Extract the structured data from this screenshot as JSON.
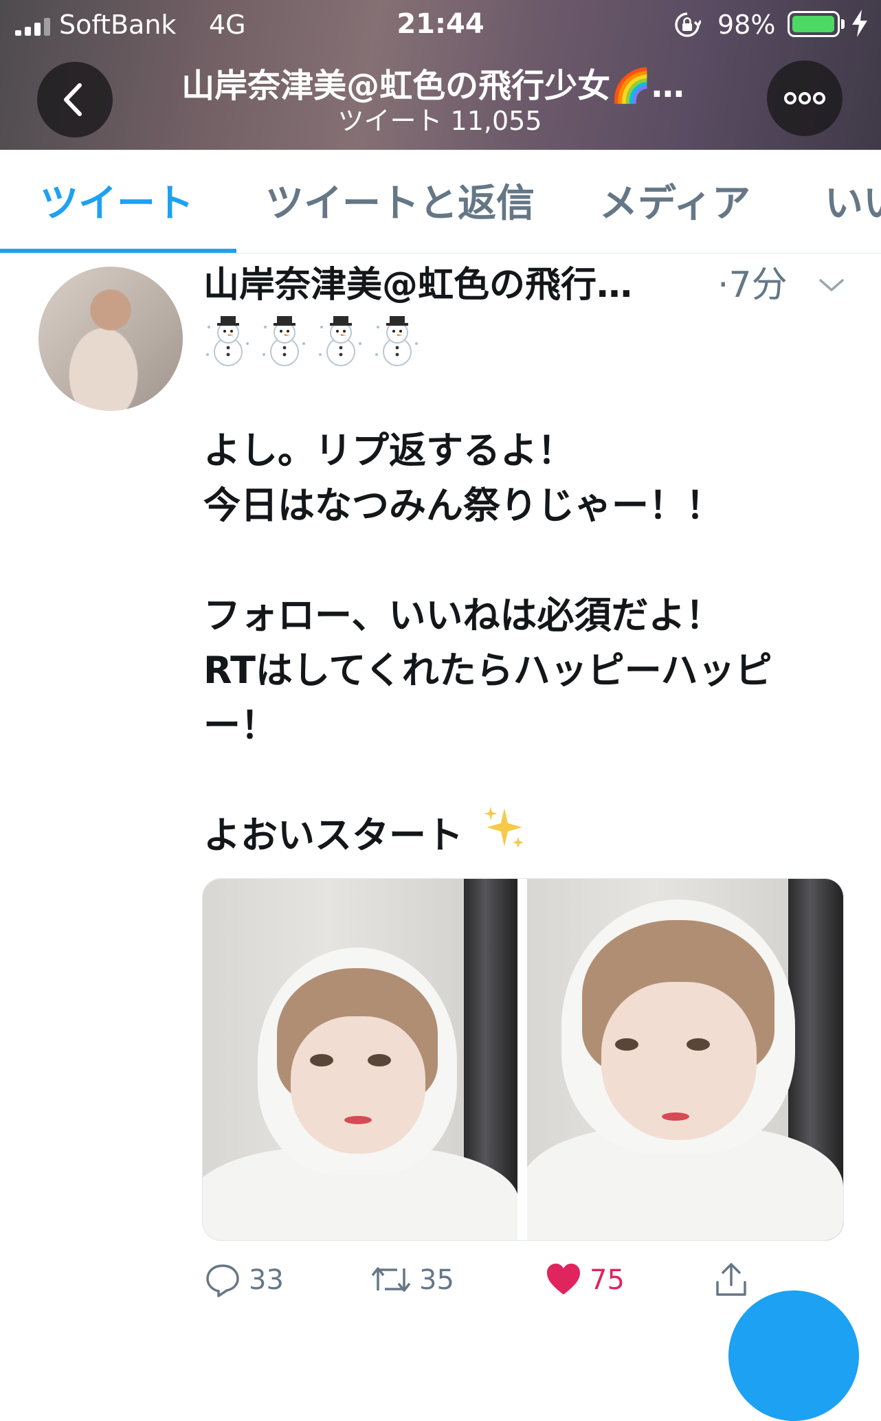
{
  "status_bar": {
    "carrier": "SoftBank",
    "network": "4G",
    "time": "21:44",
    "battery_percent": "98%",
    "battery_level": 0.98,
    "battery_color": "#4cd964"
  },
  "header": {
    "title": "山岸奈津美@虹色の飛行少女🌈…",
    "subtitle": "ツイート 11,055",
    "back_icon": "chevron-left-icon",
    "more_icon": "more-horizontal-icon"
  },
  "tabs": [
    {
      "label": "ツイート",
      "active": true
    },
    {
      "label": "ツイートと返信",
      "active": false
    },
    {
      "label": "メディア",
      "active": false
    },
    {
      "label": "いい",
      "active": false
    }
  ],
  "tweet": {
    "author": "山岸奈津美@虹色の飛行…",
    "time": "·7分",
    "emoji_line": "☃️☃️☃️☃️",
    "text": "よし。リプ返するよ！\n今日はなつみん祭りじゃー！！\n\nフォロー、いいねは必須だよ！\nRTはしてくれたらハッピーハッピ\nー！\n\nよおいスタート",
    "sparkle_icon": "sparkles-icon",
    "replies": "33",
    "retweets": "35",
    "likes": "75"
  },
  "colors": {
    "accent": "#1da1f2",
    "like": "#e0245e",
    "muted": "#657786",
    "text": "#14171a"
  }
}
